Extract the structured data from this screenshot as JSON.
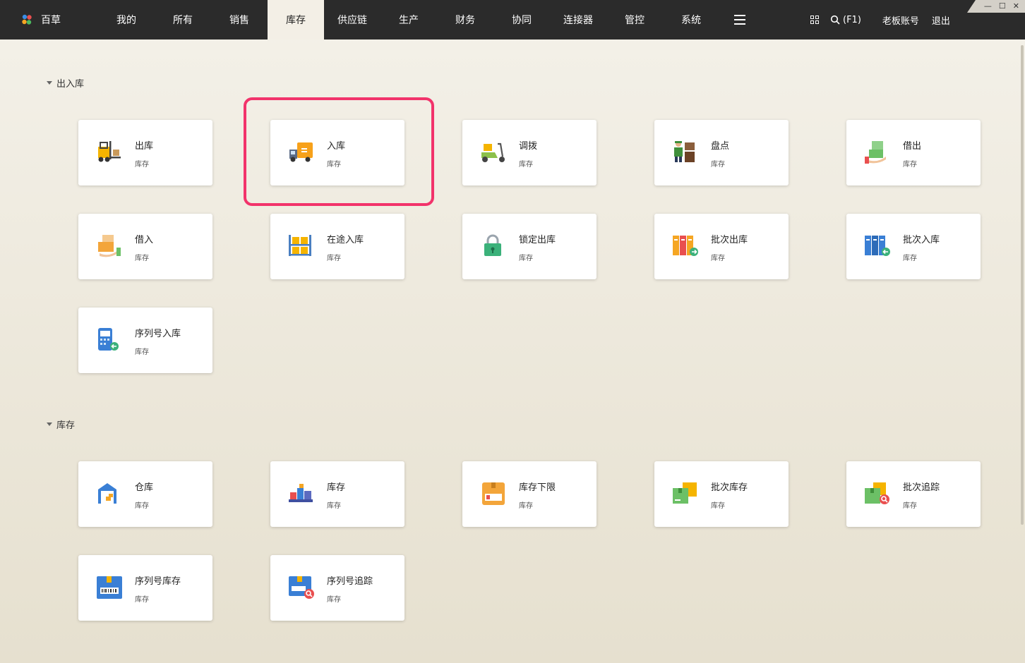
{
  "window_controls": {
    "minimize": "—",
    "maximize": "☐",
    "close": "✕"
  },
  "brand": {
    "name": "百草"
  },
  "nav": [
    {
      "label": "我的"
    },
    {
      "label": "所有"
    },
    {
      "label": "销售"
    },
    {
      "label": "库存",
      "active": true
    },
    {
      "label": "供应链"
    },
    {
      "label": "生产"
    },
    {
      "label": "财务"
    },
    {
      "label": "协同"
    },
    {
      "label": "连接器"
    },
    {
      "label": "管控"
    },
    {
      "label": "系统"
    }
  ],
  "toolbar": {
    "search_label": "(F1)",
    "account_label": "老板账号",
    "logout_label": "退出"
  },
  "sections": [
    {
      "title": "出入库",
      "cards": [
        {
          "title": "出库",
          "sub": "库存",
          "icon": "forklift-icon"
        },
        {
          "title": "入库",
          "sub": "库存",
          "icon": "delivery-truck-icon"
        },
        {
          "title": "调拨",
          "sub": "库存",
          "icon": "scooter-icon"
        },
        {
          "title": "盘点",
          "sub": "库存",
          "icon": "worker-boxes-icon"
        },
        {
          "title": "借出",
          "sub": "库存",
          "icon": "lend-boxes-icon"
        },
        {
          "title": "借入",
          "sub": "库存",
          "icon": "borrow-boxes-icon"
        },
        {
          "title": "在途入库",
          "sub": "库存",
          "icon": "shelf-icon"
        },
        {
          "title": "锁定出库",
          "sub": "库存",
          "icon": "lock-icon"
        },
        {
          "title": "批次出库",
          "sub": "库存",
          "icon": "batch-out-icon"
        },
        {
          "title": "批次入库",
          "sub": "库存",
          "icon": "batch-in-icon"
        },
        {
          "title": "序列号入库",
          "sub": "库存",
          "icon": "serial-in-icon"
        }
      ]
    },
    {
      "title": "库存",
      "cards": [
        {
          "title": "仓库",
          "sub": "库存",
          "icon": "warehouse-icon"
        },
        {
          "title": "库存",
          "sub": "库存",
          "icon": "stock-icon"
        },
        {
          "title": "库存下限",
          "sub": "库存",
          "icon": "low-stock-icon"
        },
        {
          "title": "批次库存",
          "sub": "库存",
          "icon": "batch-stock-icon"
        },
        {
          "title": "批次追踪",
          "sub": "库存",
          "icon": "batch-trace-icon"
        },
        {
          "title": "序列号库存",
          "sub": "库存",
          "icon": "serial-stock-icon"
        },
        {
          "title": "序列号追踪",
          "sub": "库存",
          "icon": "serial-trace-icon"
        }
      ]
    }
  ],
  "colors": {
    "topbar": "#2b2b2b",
    "highlight": "#f2336b",
    "active_tab": "#f3efe6"
  }
}
